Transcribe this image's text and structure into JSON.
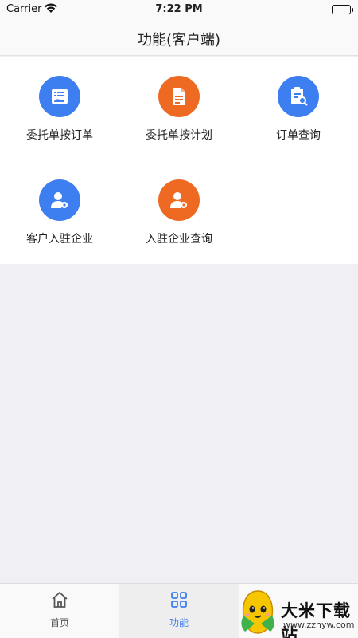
{
  "status_bar": {
    "carrier": "Carrier",
    "time": "7:22 PM"
  },
  "nav": {
    "title": "功能(客户端)"
  },
  "functions": [
    {
      "label": "委托单按订单",
      "icon": "order-delegation-icon",
      "color": "#3d7ef0"
    },
    {
      "label": "委托单按计划",
      "icon": "plan-document-icon",
      "color": "#ee6a22"
    },
    {
      "label": "订单查询",
      "icon": "document-search-icon",
      "color": "#3d7ef0"
    },
    {
      "label": "客户入驻企业",
      "icon": "user-settings-icon",
      "color": "#3d7ef0"
    },
    {
      "label": "入驻企业查询",
      "icon": "user-settings-icon",
      "color": "#ee6a22"
    }
  ],
  "tabs": [
    {
      "label": "首页",
      "icon": "home-icon",
      "active": false
    },
    {
      "label": "功能",
      "icon": "grid-icon",
      "active": true
    }
  ],
  "watermark": {
    "name": "大米下载站",
    "url": "www.zzhyw.com"
  },
  "colors": {
    "accent_blue": "#3d7ef0",
    "accent_orange": "#ee6a22"
  }
}
